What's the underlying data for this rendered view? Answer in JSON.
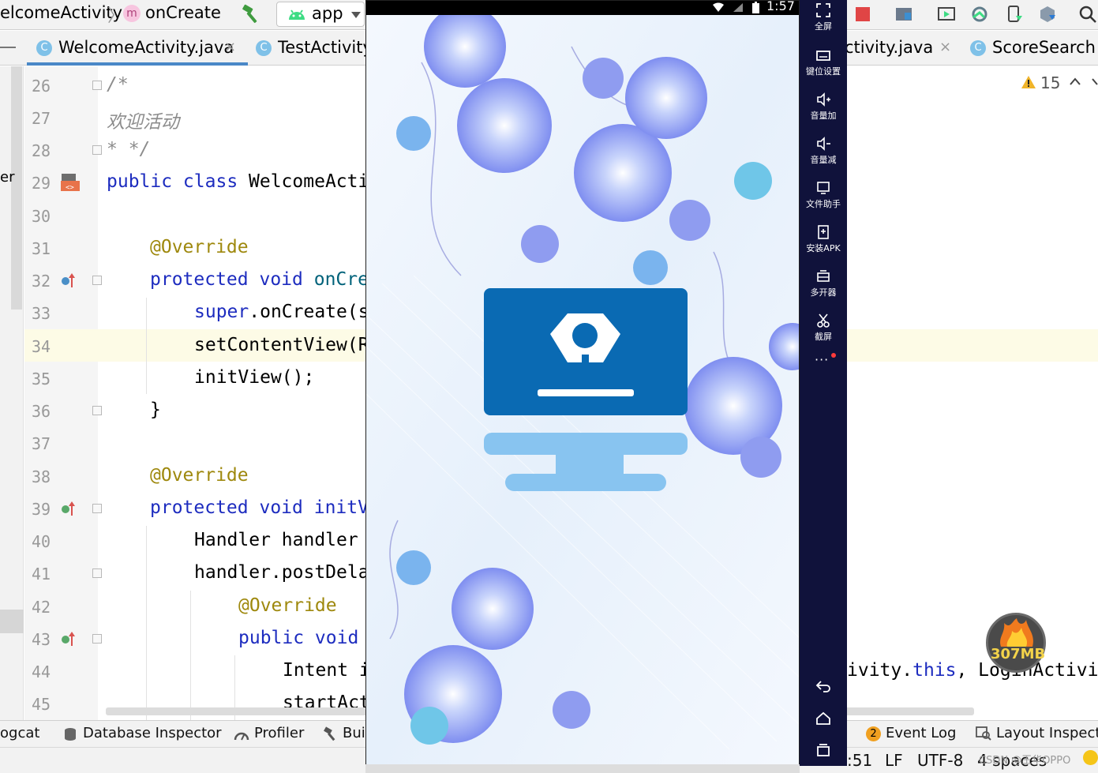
{
  "breadcrumbs": {
    "class_name": "elcomeActivity",
    "method_badge": "m",
    "method_name": "onCreate",
    "separator": "〉"
  },
  "run_config": {
    "label": "app"
  },
  "tabs": [
    {
      "badge": "C",
      "label": "WelcomeActivity.java",
      "close": "×"
    },
    {
      "badge": "C",
      "label": "TestActivity"
    },
    {
      "label": "ctivity.java",
      "close": "×"
    },
    {
      "badge": "C",
      "label": "ScoreSearch"
    }
  ],
  "inspections": {
    "warning_count": "15"
  },
  "editor": {
    "lines": [
      {
        "num": "26",
        "text": "/*"
      },
      {
        "num": "27",
        "text": "欢迎活动"
      },
      {
        "num": "28",
        "text": "* */"
      },
      {
        "num": "29",
        "kw": "public class ",
        "text": "WelcomeActi"
      },
      {
        "num": "30",
        "text": ""
      },
      {
        "num": "31",
        "text": "@Override"
      },
      {
        "num": "32",
        "kw": "protected void ",
        "text": "onCre"
      },
      {
        "num": "33",
        "kw": "super",
        "text": ".onCreate(s"
      },
      {
        "num": "34",
        "text": "setContentView(R"
      },
      {
        "num": "35",
        "text": "initView();"
      },
      {
        "num": "36",
        "text": "}"
      },
      {
        "num": "37",
        "text": ""
      },
      {
        "num": "38",
        "text": "@Override"
      },
      {
        "num": "39",
        "kw": "protected void ",
        "text": "initV"
      },
      {
        "num": "40",
        "text": "Handler handler "
      },
      {
        "num": "41",
        "text": "handler.postDela"
      },
      {
        "num": "42",
        "text": "@Override"
      },
      {
        "num": "43",
        "kw": "public void",
        "text": ""
      },
      {
        "num": "44",
        "text": "Intent i"
      },
      {
        "num": "45",
        "text": "startAct"
      }
    ],
    "line44_right_a": "ivity.",
    "line44_right_kw": "this",
    "line44_right_b": ", LoginActivit",
    "left_strip_text": "er"
  },
  "tool_windows": {
    "logcat": "ogcat",
    "database_inspector": "Database Inspector",
    "profiler": "Profiler",
    "build": "Bui",
    "event_log_count": "2",
    "event_log": "Event Log",
    "layout_inspector": "Layout Inspecto"
  },
  "status_bar": {
    "position": ":51",
    "line_sep": "LF",
    "encoding": "UTF-8",
    "indent": "4 spaces"
  },
  "emulator": {
    "time": "1:57",
    "side_panel": [
      {
        "label": "全屏",
        "icon": "fullscreen-icon"
      },
      {
        "label": "键位设置",
        "icon": "keyboard-icon"
      },
      {
        "label": "音量加",
        "icon": "volume-up-icon"
      },
      {
        "label": "音量减",
        "icon": "volume-down-icon"
      },
      {
        "label": "文件助手",
        "icon": "file-assistant-icon"
      },
      {
        "label": "安装APK",
        "icon": "install-apk-icon"
      },
      {
        "label": "多开器",
        "icon": "multi-instance-icon"
      },
      {
        "label": "截屏",
        "icon": "screenshot-icon"
      }
    ],
    "more": "···",
    "memory": "307MB"
  },
  "watermark": "CSDN @王华OPPO",
  "colors": {
    "keyword": "#1d2cbf",
    "annotation": "#9e880d",
    "emu_panel": "#10123b",
    "monitor_blue": "#0a6ab3",
    "monitor_stand": "#88c4f0"
  }
}
